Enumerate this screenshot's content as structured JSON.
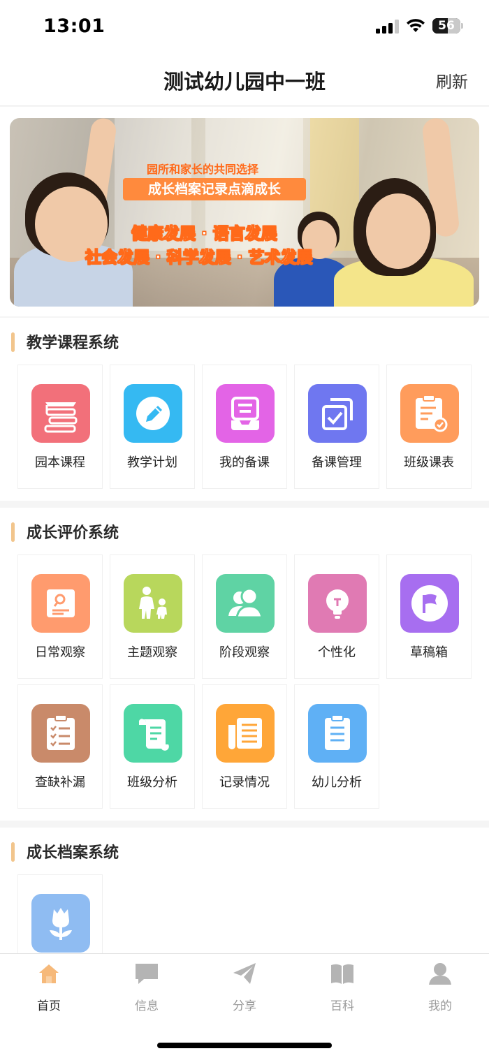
{
  "status_bar": {
    "time": "13:01",
    "battery": "56",
    "battery_level": 0.56
  },
  "nav": {
    "title": "测试幼儿园中一班",
    "refresh": "刷新"
  },
  "banner": {
    "subtitle": "园所和家长的共同选择",
    "pill": "成长档案记录点滴成长",
    "line1": "健康发展 · 语言发展",
    "line2": "社会发展 · 科学发展 · 艺术发展"
  },
  "sections": [
    {
      "title": "教学课程系统",
      "items": [
        {
          "label": "园本课程",
          "icon": "graduation-cap-books-icon",
          "color": "#f2707a"
        },
        {
          "label": "教学计划",
          "icon": "pencil-icon",
          "color": "#35b9f2"
        },
        {
          "label": "我的备课",
          "icon": "tray-icon",
          "color": "#e364e6"
        },
        {
          "label": "备课管理",
          "icon": "copy-check-icon",
          "color": "#6f77f0"
        },
        {
          "label": "班级课表",
          "icon": "clipboard-check-icon",
          "color": "#ff9c5c"
        }
      ]
    },
    {
      "title": "成长评价系统",
      "items": [
        {
          "label": "日常观察",
          "icon": "search-document-icon",
          "color": "#ff9b6e"
        },
        {
          "label": "主题观察",
          "icon": "parent-child-icon",
          "color": "#b8d75c"
        },
        {
          "label": "阶段观察",
          "icon": "users-icon",
          "color": "#5fd3a4"
        },
        {
          "label": "个性化",
          "icon": "lightbulb-icon",
          "color": "#e07ab3"
        },
        {
          "label": "草稿箱",
          "icon": "flag-icon",
          "color": "#a76ef0"
        },
        {
          "label": "查缺补漏",
          "icon": "checklist-icon",
          "color": "#c98a6a"
        },
        {
          "label": "班级分析",
          "icon": "scroll-icon",
          "color": "#4ed7a5"
        },
        {
          "label": "记录情况",
          "icon": "newspaper-icon",
          "color": "#ffa638"
        },
        {
          "label": "幼儿分析",
          "icon": "clipboard-list-icon",
          "color": "#5fb0f5"
        }
      ]
    },
    {
      "title": "成长档案系统",
      "items": [
        {
          "label": "",
          "icon": "tulip-icon",
          "color": "#8fbcf2"
        }
      ]
    }
  ],
  "tabs": [
    {
      "label": "首页",
      "icon": "home-icon",
      "active": true
    },
    {
      "label": "信息",
      "icon": "message-icon",
      "active": false
    },
    {
      "label": "分享",
      "icon": "send-icon",
      "active": false
    },
    {
      "label": "百科",
      "icon": "book-icon",
      "active": false
    },
    {
      "label": "我的",
      "icon": "user-icon",
      "active": false
    }
  ]
}
